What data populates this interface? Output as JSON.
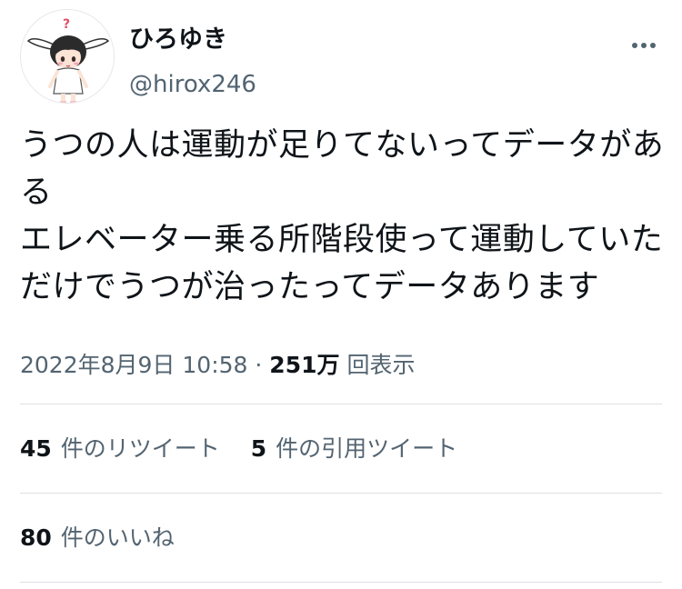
{
  "user": {
    "display_name": "ひろゆき",
    "handle": "@hirox246"
  },
  "tweet": {
    "lines": [
      "うつの人は運動が足りてないってデータがあ",
      "る",
      "エレベーター乗る所階段使って運動していた",
      "だけでうつが治ったってデータあります"
    ],
    "date": "2022年8月9日 10:58",
    "separator": "·",
    "views_count": "251万",
    "views_label": "回表示"
  },
  "stats": {
    "retweets_count": "45",
    "retweets_label": "件のリツイート",
    "quotes_count": "5",
    "quotes_label": "件の引用ツイート",
    "likes_count": "80",
    "likes_label": "件のいいね"
  },
  "colors": {
    "text_primary": "#0f1419",
    "text_secondary": "#536471",
    "divider": "#dcdfe3"
  },
  "icons": {
    "more": "more-options-icon",
    "avatar": "avatar-illustration"
  }
}
